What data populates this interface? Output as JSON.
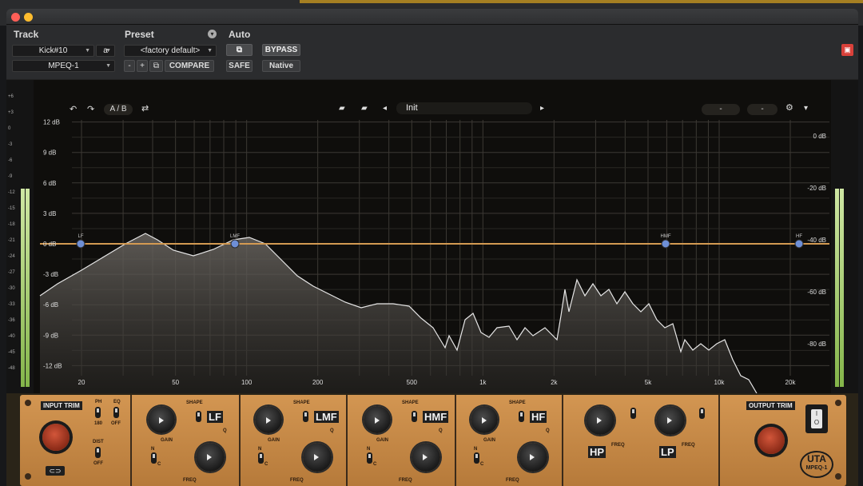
{
  "header": {
    "track_label": "Track",
    "preset_label": "Preset",
    "auto_label": "Auto",
    "track_value": "Kick#10",
    "track_slot": "a",
    "plugin_name": "MPEQ-1",
    "preset_value": "<factory default>",
    "minus": "-",
    "plus": "+",
    "compare": "COMPARE",
    "bypass": "BYPASS",
    "safe": "SAFE",
    "native": "Native"
  },
  "toolbar": {
    "ab": "A / B",
    "preset_name": "Init",
    "pill_1": "-",
    "pill_2": "-"
  },
  "graph": {
    "db_left": [
      "12 dB",
      "9 dB",
      "6 dB",
      "3 dB",
      "0 dB",
      "-3 dB",
      "-6 dB",
      "-9 dB",
      "-12 dB"
    ],
    "db_right": [
      "0 dB",
      "-20 dB",
      "-40 dB",
      "-60 dB",
      "-80 dB"
    ],
    "freq": [
      "20",
      "50",
      "100",
      "200",
      "500",
      "1k",
      "2k",
      "5k",
      "10k",
      "20k"
    ],
    "bands": [
      "LF",
      "LMF",
      "HMF",
      "HF"
    ]
  },
  "meter": {
    "ticks": [
      "+6",
      "+3",
      "0",
      "-3",
      "-6",
      "-9",
      "-12",
      "-15",
      "-18",
      "-21",
      "-24",
      "-27",
      "-30",
      "-33",
      "-36",
      "-40",
      "-45",
      "-48"
    ]
  },
  "panel": {
    "input_trim": "INPUT TRIM",
    "output_trim": "OUTPUT TRIM",
    "ph": "PH",
    "ph_180": "180",
    "eq": "EQ",
    "eq_off": "OFF",
    "dist": "DIST",
    "dist_off": "OFF",
    "lf": "LF",
    "lmf": "LMF",
    "hmf": "HMF",
    "hf": "HF",
    "hp": "HP",
    "lp": "LP",
    "shape": "SHAPE",
    "gain": "GAIN",
    "freq": "FREQ",
    "q": "Q",
    "n": "N",
    "c": "C",
    "brand": "UTA",
    "model": "MPEQ-1",
    "power_on": "I",
    "power_off": "O"
  },
  "colors": {
    "eq_line": "#d39a52",
    "node": "#6e8fd6",
    "accent": "#c58a45",
    "meter": "#a8d070",
    "close": "#d9413a"
  }
}
